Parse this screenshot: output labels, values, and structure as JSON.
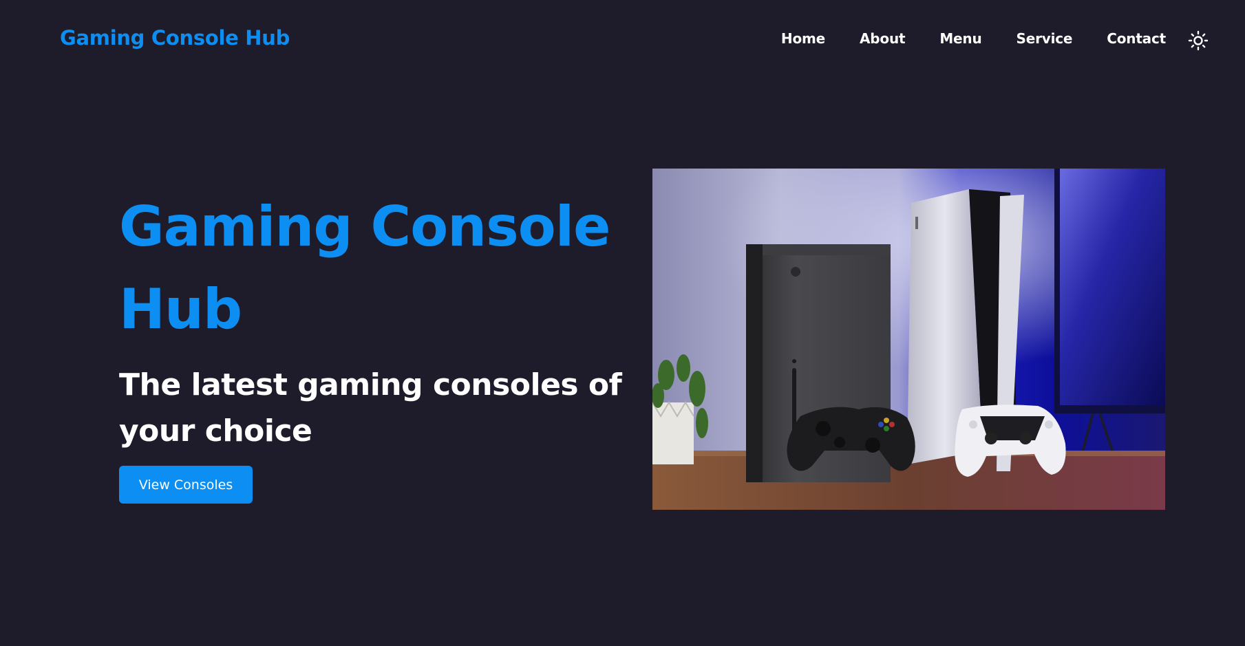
{
  "navbar": {
    "logo": "Gaming Console Hub",
    "links": [
      "Home",
      "About",
      "Menu",
      "Service",
      "Contact"
    ],
    "theme_toggle_icon": "sun-icon"
  },
  "hero": {
    "title": "Gaming Console Hub",
    "subtitle": "The latest gaming consoles of your choice",
    "cta_label": "View Consoles",
    "image_alt": "gaming-consoles-photo"
  },
  "colors": {
    "background": "#1e1c2a",
    "accent": "#0c8ef3",
    "text": "#ffffff"
  }
}
